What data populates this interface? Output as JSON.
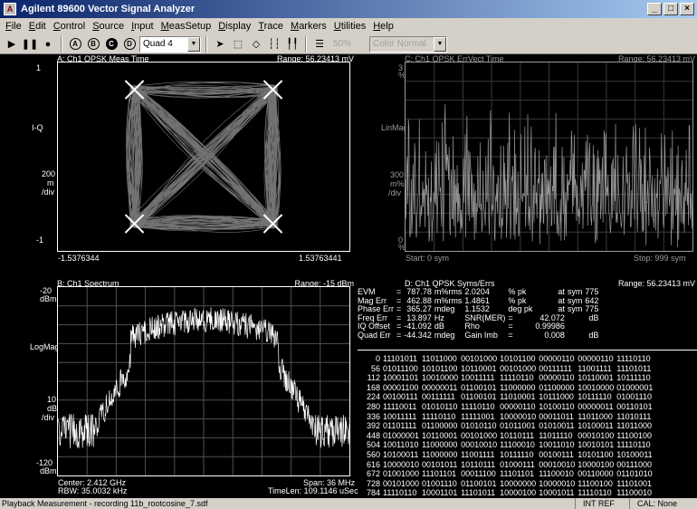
{
  "window": {
    "title": "Agilent 89600 Vector Signal Analyzer"
  },
  "menu": [
    "File",
    "Edit",
    "Control",
    "Source",
    "Input",
    "MeasSetup",
    "Display",
    "Trace",
    "Markers",
    "Utilities",
    "Help"
  ],
  "toolbar": {
    "circles": [
      "A",
      "B",
      "C",
      "D"
    ],
    "layout_select": "Quad 4",
    "zoom_value": "50%",
    "color_select": "Color Normal"
  },
  "panel_a": {
    "title": "A: Ch1 QPSK Meas Time",
    "range": "Range: 56.23413 mV",
    "y_top": "1",
    "y_mid": "I-Q",
    "y_scale": [
      "200",
      "m",
      "/div"
    ],
    "y_bot": "-1",
    "x_left": "-1.5376344",
    "x_right": "1.53763441"
  },
  "panel_b": {
    "title": "B: Ch1 Spectrum",
    "range": "Range: -15 dBm",
    "y_top": [
      "-20",
      "dBm"
    ],
    "y_mid": "LogMag",
    "y_scale": [
      "10",
      "dB",
      "/div"
    ],
    "y_bot": [
      "-120",
      "dBm"
    ],
    "center": "Center: 2.412 GHz",
    "rbw": "RBW: 35.0032 kHz",
    "span": "Span: 36 MHz",
    "timelen": "TimeLen: 109.1146 uSec"
  },
  "panel_c": {
    "title": "C: Ch1 QPSK ErrVect Time",
    "range": "Range: 56.23413 mV",
    "y_top": [
      "3",
      "%"
    ],
    "y_mid": "LinMag",
    "y_scale": [
      "300",
      "m%",
      "/div"
    ],
    "y_bot": [
      "0",
      "%"
    ],
    "start": "Start: 0  sym",
    "stop": "Stop: 999  sym"
  },
  "panel_d": {
    "title": "D: Ch1 QPSK Syms/Errs",
    "range": "Range: 56.23413 mV",
    "meas": [
      [
        "EVM",
        "=",
        "787.78",
        "m%rms",
        "2.0204",
        "% pk",
        "at",
        "sym",
        "775"
      ],
      [
        "Mag Err",
        "=",
        "462.88",
        "m%rms",
        "1.4861",
        "% pk",
        "at",
        "sym",
        "642"
      ],
      [
        "Phase Err",
        "=",
        "365.27",
        "mdeg",
        "1.1532",
        "deg pk",
        "at",
        "sym",
        "775"
      ],
      [
        "Freq Err",
        "=",
        "13.897",
        "Hz",
        "SNR(MER)",
        "=",
        "42.072",
        "",
        "dB"
      ],
      [
        "IQ Offset",
        "=",
        "-41.092",
        "dB",
        "Rho",
        "=",
        "0.99986",
        "",
        ""
      ],
      [
        "Quad Err",
        "=",
        "-44.342",
        "mdeg",
        "Gain Imb",
        "=",
        "0.008",
        "",
        "dB"
      ]
    ],
    "symbols": [
      [
        "0",
        "11101011",
        "11011000",
        "00101000",
        "10101100",
        "00000110",
        "00000110",
        "11110110"
      ],
      [
        "56",
        "01011100",
        "10101100",
        "10110001",
        "00101000",
        "00111111",
        "11001111",
        "11101011"
      ],
      [
        "112",
        "10001101",
        "10010000",
        "10011111",
        "11110110",
        "00000110",
        "10110001",
        "10111110"
      ],
      [
        "168",
        "00001100",
        "00000011",
        "01100101",
        "11000000",
        "01100000",
        "10010000",
        "01000001"
      ],
      [
        "224",
        "00100111",
        "00111111",
        "01100101",
        "11010001",
        "10111000",
        "10111110",
        "01001110"
      ],
      [
        "280",
        "11110011",
        "01010110",
        "11110110",
        "00000110",
        "10100110",
        "00000011",
        "00110101"
      ],
      [
        "336",
        "10011111",
        "11110110",
        "11111001",
        "10000010",
        "00011011",
        "11011000",
        "11010111"
      ],
      [
        "392",
        "01101111",
        "01100000",
        "01010110",
        "01011001",
        "01010011",
        "10100011",
        "11011000"
      ],
      [
        "448",
        "01000001",
        "10110001",
        "00101000",
        "10110111",
        "11011110",
        "00010100",
        "11100100"
      ],
      [
        "504",
        "10011010",
        "11000000",
        "00010010",
        "11100010",
        "10011010",
        "10010101",
        "11110110"
      ],
      [
        "560",
        "10100011",
        "11000000",
        "11001111",
        "10111110",
        "00100111",
        "10101100",
        "10100011"
      ],
      [
        "616",
        "10000010",
        "00101011",
        "10110111",
        "01000111",
        "00010010",
        "10000100",
        "00111000"
      ],
      [
        "672",
        "01001000",
        "11101101",
        "00011100",
        "11101101",
        "11100010",
        "00110000",
        "01101010"
      ],
      [
        "728",
        "00101000",
        "01001110",
        "01100101",
        "10000000",
        "10000010",
        "11100100",
        "11101001"
      ],
      [
        "784",
        "11110110",
        "10001101",
        "11101011",
        "10000100",
        "10001011",
        "11110110",
        "11100010"
      ]
    ]
  },
  "status": {
    "message": "Playback Measurement - recording 11b_rootcosine_7.sdf",
    "ref": "INT REF",
    "cal": "CAL: None"
  }
}
